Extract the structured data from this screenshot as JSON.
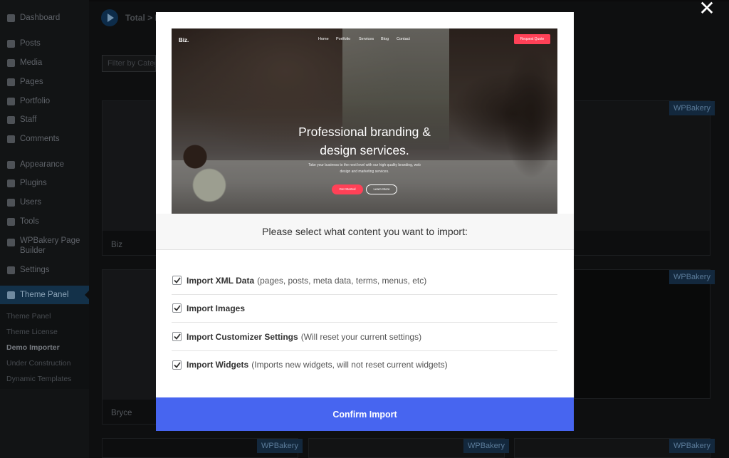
{
  "admin_menu": {
    "items": [
      {
        "label": "Dashboard",
        "icon": "dashboard-icon"
      },
      {
        "label": "Posts",
        "icon": "pin-icon"
      },
      {
        "label": "Media",
        "icon": "media-icon"
      },
      {
        "label": "Pages",
        "icon": "pages-icon"
      },
      {
        "label": "Portfolio",
        "icon": "portfolio-icon"
      },
      {
        "label": "Staff",
        "icon": "staff-icon"
      },
      {
        "label": "Comments",
        "icon": "comments-icon"
      },
      {
        "label": "Appearance",
        "icon": "brush-icon"
      },
      {
        "label": "Plugins",
        "icon": "plugin-icon"
      },
      {
        "label": "Users",
        "icon": "users-icon"
      },
      {
        "label": "Tools",
        "icon": "tools-icon"
      },
      {
        "label": "WPBakery Page Builder",
        "icon": "wpbakery-icon"
      },
      {
        "label": "Settings",
        "icon": "settings-icon"
      },
      {
        "label": "Theme Panel",
        "icon": "theme-panel-icon"
      }
    ],
    "submenu": [
      "Theme Panel",
      "Theme License",
      "Demo Importer",
      "Under Construction",
      "Dynamic Templates"
    ]
  },
  "background_page": {
    "title": "Total > D",
    "filter_placeholder": "Filter by Categ",
    "demo_names": [
      "Biz",
      "Bryce"
    ],
    "badge": "WPBakery"
  },
  "modal": {
    "close_glyph": "✕",
    "preview": {
      "brand": "Biz.",
      "nav": [
        "Home",
        "Portfolio",
        "Services",
        "Blog",
        "Contact"
      ],
      "cta": "Request Quote",
      "headline_line1": "Professional branding &",
      "headline_line2": "design services.",
      "subtext": "Take your business to the next level with our high quality branding, web design and marketing services.",
      "button_primary": "Get Started",
      "button_secondary": "Learn More"
    },
    "prompt": "Please select what content you want to import:",
    "options": [
      {
        "label": "Import XML Data",
        "desc": "(pages, posts, meta data, terms, menus, etc)",
        "checked": true
      },
      {
        "label": "Import Images",
        "desc": "",
        "checked": true
      },
      {
        "label": "Import Customizer Settings",
        "desc": "(Will reset your current settings)",
        "checked": true
      },
      {
        "label": "Import Widgets",
        "desc": "(Imports new widgets, will not reset current widgets)",
        "checked": true
      }
    ],
    "confirm_label": "Confirm Import"
  },
  "colors": {
    "accent": "#4765f0",
    "preview_cta": "#ff4157",
    "overlay": "#000000"
  }
}
